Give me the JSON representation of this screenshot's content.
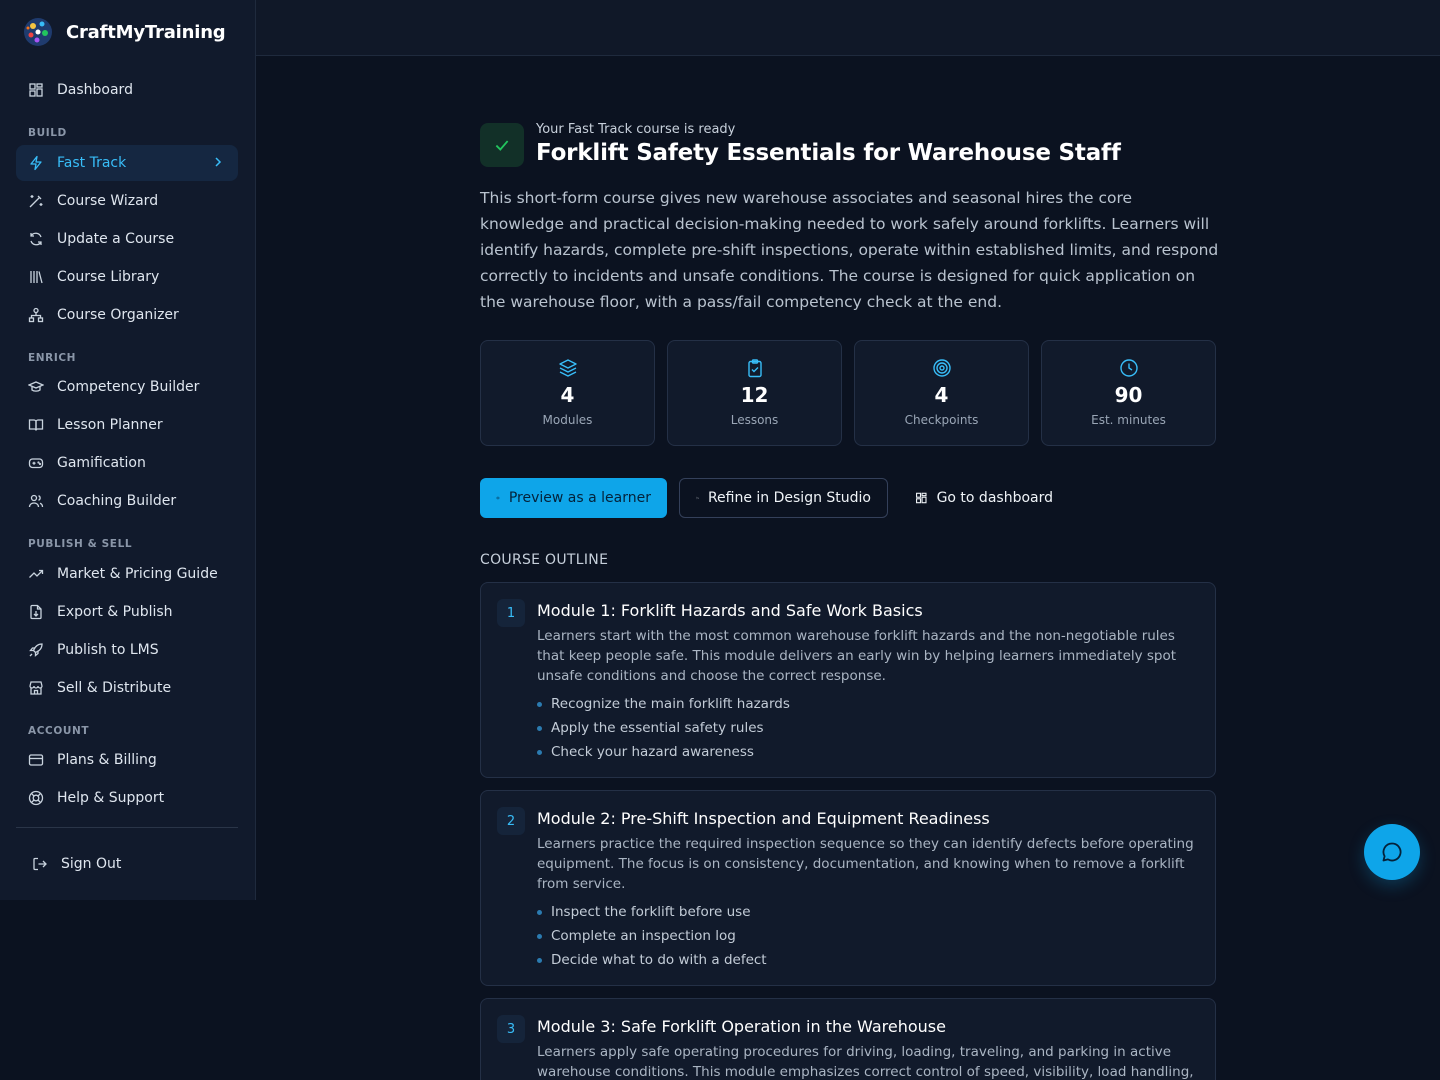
{
  "brand": {
    "name": "CraftMyTraining",
    "logo_icon": "globe-logo-icon"
  },
  "colors": {
    "accent": "#0ea5e9",
    "accent_text": "#38bdf8",
    "background": "#0b1220",
    "sidebar": "#111a2c",
    "success": "#22c55e"
  },
  "sidebar": {
    "dashboard": {
      "label": "Dashboard",
      "icon": "dashboard-grid-icon"
    },
    "sections": {
      "build": "BUILD",
      "enrich": "ENRICH",
      "publish_sell": "PUBLISH & SELL",
      "account": "ACCOUNT"
    },
    "build_items": [
      {
        "label": "Fast Track",
        "icon": "lightning-icon",
        "active": true
      },
      {
        "label": "Course Wizard",
        "icon": "magic-wand-icon"
      },
      {
        "label": "Update a Course",
        "icon": "refresh-icon"
      },
      {
        "label": "Course Library",
        "icon": "library-icon"
      },
      {
        "label": "Course Organizer",
        "icon": "organizer-icon"
      }
    ],
    "enrich_items": [
      {
        "label": "Competency Builder",
        "icon": "graduation-cap-icon"
      },
      {
        "label": "Lesson Planner",
        "icon": "open-book-icon"
      },
      {
        "label": "Gamification",
        "icon": "gamepad-icon"
      },
      {
        "label": "Coaching Builder",
        "icon": "users-icon"
      }
    ],
    "publish_items": [
      {
        "label": "Market & Pricing Guide",
        "icon": "trending-up-icon"
      },
      {
        "label": "Export & Publish",
        "icon": "file-export-icon"
      },
      {
        "label": "Publish to LMS",
        "icon": "rocket-icon"
      },
      {
        "label": "Sell & Distribute",
        "icon": "store-icon"
      }
    ],
    "account_items": [
      {
        "label": "Plans & Billing",
        "icon": "credit-card-icon"
      },
      {
        "label": "Help & Support",
        "icon": "lifebuoy-icon"
      }
    ],
    "sign_out": {
      "label": "Sign Out",
      "icon": "sign-out-icon"
    }
  },
  "main": {
    "ready_label": "Your Fast Track course is ready",
    "title": "Forklift Safety Essentials for Warehouse Staff",
    "description": "This short-form course gives new warehouse associates and seasonal hires the core knowledge and practical decision-making needed to work safely around forklifts. Learners will identify hazards, complete pre-shift inspections, operate within established limits, and respond correctly to incidents and unsafe conditions. The course is designed for quick application on the warehouse floor, with a pass/fail competency check at the end.",
    "stats": [
      {
        "value": "4",
        "label": "Modules",
        "icon": "layers-icon"
      },
      {
        "value": "12",
        "label": "Lessons",
        "icon": "clipboard-check-icon"
      },
      {
        "value": "4",
        "label": "Checkpoints",
        "icon": "target-icon"
      },
      {
        "value": "90",
        "label": "Est. minutes",
        "icon": "clock-icon"
      }
    ],
    "actions": {
      "preview": "Preview as a learner",
      "refine": "Refine in Design Studio",
      "dashboard": "Go to dashboard"
    },
    "outline_label": "COURSE OUTLINE",
    "modules": [
      {
        "number": "1",
        "title": "Module 1: Forklift Hazards and Safe Work Basics",
        "description": "Learners start with the most common warehouse forklift hazards and the non-negotiable rules that keep people safe. This module delivers an early win by helping learners immediately spot unsafe conditions and choose the correct response.",
        "points": [
          "Recognize the main forklift hazards",
          "Apply the essential safety rules",
          "Check your hazard awareness"
        ]
      },
      {
        "number": "2",
        "title": "Module 2: Pre-Shift Inspection and Equipment Readiness",
        "description": "Learners practice the required inspection sequence so they can identify defects before operating equipment. The focus is on consistency, documentation, and knowing when to remove a forklift from service.",
        "points": [
          "Inspect the forklift before use",
          "Complete an inspection log",
          "Decide what to do with a defect"
        ]
      },
      {
        "number": "3",
        "title": "Module 3: Safe Forklift Operation in the Warehouse",
        "description": "Learners apply safe operating procedures for driving, loading, traveling, and parking in active warehouse conditions. This module emphasizes correct control of speed, visibility, load handling, and",
        "points": []
      }
    ]
  },
  "chat": {
    "icon": "chat-bubble-icon"
  }
}
